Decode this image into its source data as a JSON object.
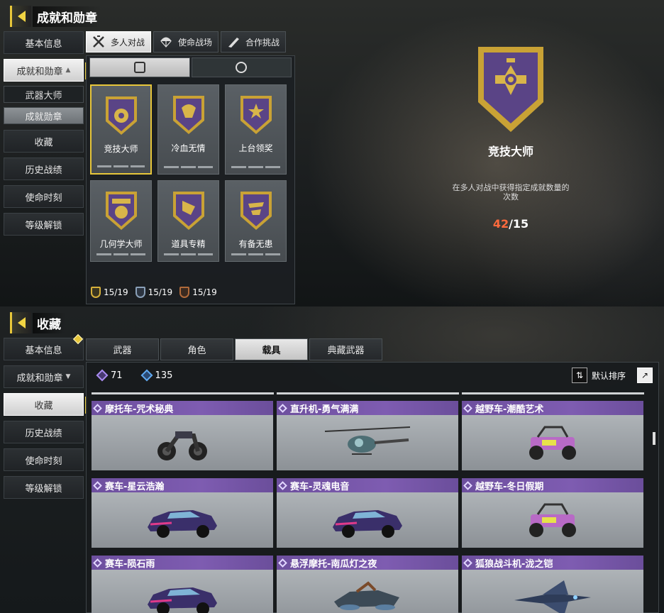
{
  "top": {
    "title": "成就和勋章",
    "side_menu": [
      {
        "label": "基本信息"
      },
      {
        "label": "成就和勋章",
        "caret": "▲"
      },
      {
        "label": "武器大师",
        "sub": true
      },
      {
        "label": "成就勋章",
        "sub": true
      },
      {
        "label": "收藏"
      },
      {
        "label": "历史战绩"
      },
      {
        "label": "使命时刻"
      },
      {
        "label": "等级解锁"
      }
    ],
    "mode_tabs": [
      {
        "label": "多人对战",
        "icon": "crossed-guns-icon"
      },
      {
        "label": "使命战场",
        "icon": "parachute-icon"
      },
      {
        "label": "合作挑战",
        "icon": "rifle-icon"
      }
    ],
    "medals": [
      {
        "name": "竞技大师"
      },
      {
        "name": "冷血无情"
      },
      {
        "name": "上台领奖"
      },
      {
        "name": "几何学大师"
      },
      {
        "name": "道具专精"
      },
      {
        "name": "有备无患"
      }
    ],
    "counts": [
      {
        "value": "15/19",
        "color": "#d6b03a"
      },
      {
        "value": "15/19",
        "color": "#8aa0b8"
      },
      {
        "value": "15/19",
        "color": "#b06a3a"
      }
    ],
    "detail": {
      "name": "竞技大师",
      "description": "在多人对战中获得指定成就数量的次数",
      "current": "42",
      "total": "/15"
    }
  },
  "bottom": {
    "title": "收藏",
    "side_menu": [
      {
        "label": "基本信息"
      },
      {
        "label": "成就和勋章",
        "caret": "▼"
      },
      {
        "label": "收藏"
      },
      {
        "label": "历史战绩"
      },
      {
        "label": "使命时刻"
      },
      {
        "label": "等级解锁"
      }
    ],
    "tabs": [
      "武器",
      "角色",
      "载具",
      "典藏武器"
    ],
    "count_purple": "71",
    "count_blue": "135",
    "sort_label": "默认排序",
    "vehicles": [
      {
        "name": "摩托车-咒术秘典",
        "icon": "motorcycle-icon"
      },
      {
        "name": "直升机-勇气满满",
        "icon": "helicopter-icon"
      },
      {
        "name": "越野车-潮酷艺术",
        "icon": "buggy-icon"
      },
      {
        "name": "赛车-星云浩瀚",
        "icon": "race-car-icon"
      },
      {
        "name": "赛车-灵魂电音",
        "icon": "race-car-icon"
      },
      {
        "name": "越野车-冬日假期",
        "icon": "buggy-icon"
      },
      {
        "name": "赛车-陨石雨",
        "icon": "race-car-icon"
      },
      {
        "name": "悬浮摩托-南瓜灯之夜",
        "icon": "hoverbike-icon"
      },
      {
        "name": "狐狼战斗机-泷之铠",
        "icon": "jet-icon"
      }
    ]
  },
  "colors": {
    "accent": "#e7c63a",
    "vehicle_label": "#7e5cb1",
    "progress_current": "#ff6a3d"
  }
}
